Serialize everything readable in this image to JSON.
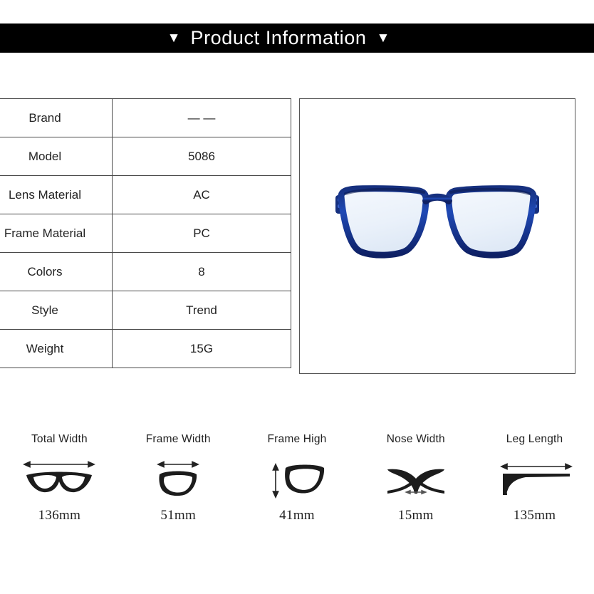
{
  "header": {
    "left_marker": "▼",
    "title": "Product Information",
    "right_marker": "▼",
    "background_color": "#000000",
    "text_color": "#ffffff"
  },
  "spec_table": {
    "rows": [
      {
        "label": "Brand",
        "value": "— —"
      },
      {
        "label": "Model",
        "value": "5086"
      },
      {
        "label": "Lens Material",
        "value": "AC"
      },
      {
        "label": "Frame Material",
        "value": "PC"
      },
      {
        "label": "Colors",
        "value": "8"
      },
      {
        "label": "Style",
        "value": "Trend"
      },
      {
        "label": "Weight",
        "value": "15G"
      }
    ]
  },
  "product_photo": {
    "alt": "blue translucent square eyeglasses front view",
    "frame_color": "#1b3fa0",
    "frame_color_dark": "#0d1f52",
    "lens_color": "#eef3fa"
  },
  "measurements": [
    {
      "label": "Total Width",
      "value": "136mm",
      "icon": "full-glasses-width-icon"
    },
    {
      "label": "Frame Width",
      "value": "51mm",
      "icon": "single-rim-width-icon"
    },
    {
      "label": "Frame High",
      "value": "41mm",
      "icon": "single-rim-height-icon"
    },
    {
      "label": "Nose Width",
      "value": "15mm",
      "icon": "nose-bridge-icon"
    },
    {
      "label": "Leg Length",
      "value": "135mm",
      "icon": "temple-arm-icon"
    }
  ]
}
